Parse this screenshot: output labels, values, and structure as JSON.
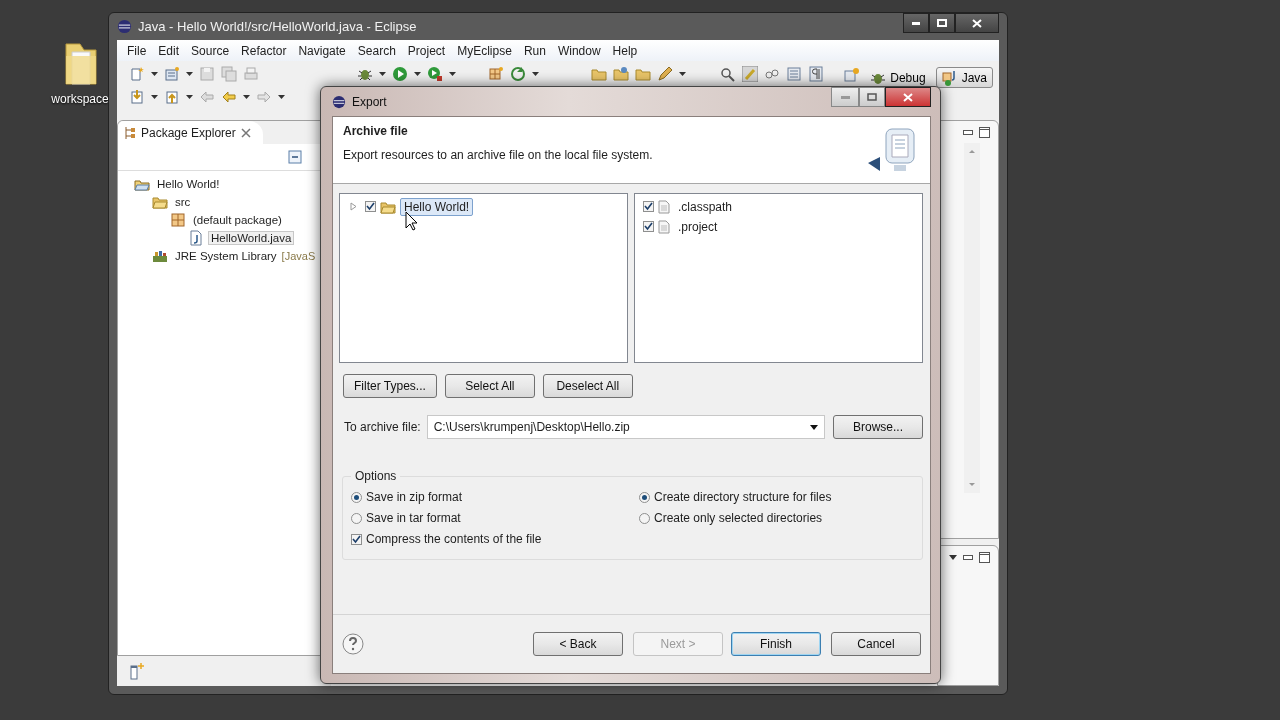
{
  "desktop": {
    "icons": [
      {
        "label": "workspace"
      }
    ]
  },
  "window": {
    "title": "Java - Hello World!/src/HelloWorld.java - Eclipse",
    "menu": [
      "File",
      "Edit",
      "Source",
      "Refactor",
      "Navigate",
      "Search",
      "Project",
      "MyEclipse",
      "Run",
      "Window",
      "Help"
    ],
    "perspectives": [
      {
        "label": "Debug",
        "selected": false
      },
      {
        "label": "Java",
        "selected": true
      }
    ],
    "package_explorer": {
      "tab": "Package Explorer",
      "tree": [
        {
          "label": "Hello World!",
          "kind": "project",
          "selected": false,
          "children": [
            {
              "label": "src",
              "kind": "folder",
              "selected": false,
              "children": [
                {
                  "label": "(default package)",
                  "kind": "package",
                  "selected": false,
                  "children": [
                    {
                      "label": "HelloWorld.java",
                      "kind": "file",
                      "selected": true
                    }
                  ]
                }
              ]
            },
            {
              "label": "JRE System Library",
              "suffix": "[JavaS",
              "kind": "library",
              "selected": false
            }
          ]
        }
      ]
    }
  },
  "dialog": {
    "title": "Export",
    "heading": "Archive file",
    "description": "Export resources to an archive file on the local file system.",
    "resources": [
      {
        "label": "Hello World!",
        "checked": true,
        "selected": true,
        "expanded": false
      }
    ],
    "files": [
      {
        "label": ".classpath",
        "checked": true
      },
      {
        "label": ".project",
        "checked": true
      }
    ],
    "selection_buttons": [
      "Filter Types...",
      "Select All",
      "Deselect All"
    ],
    "archive_label": "To archive file:",
    "archive_value": "C:\\Users\\krumpenj\\Desktop\\Hello.zip",
    "browse": "Browse...",
    "options": {
      "title": "Options",
      "format": [
        {
          "label": "Save in zip format",
          "selected": true
        },
        {
          "label": "Save in tar format",
          "selected": false
        }
      ],
      "compress": {
        "label": "Compress the contents of the file",
        "checked": true
      },
      "structure": [
        {
          "label": "Create directory structure for files",
          "selected": true
        },
        {
          "label": "Create only selected directories",
          "selected": false
        }
      ]
    },
    "buttons": [
      {
        "label": "< Back",
        "disabled": false,
        "default": false
      },
      {
        "label": "Next >",
        "disabled": true,
        "default": false
      },
      {
        "label": "Finish",
        "disabled": false,
        "default": true
      },
      {
        "label": "Cancel",
        "disabled": false,
        "default": false
      }
    ]
  }
}
